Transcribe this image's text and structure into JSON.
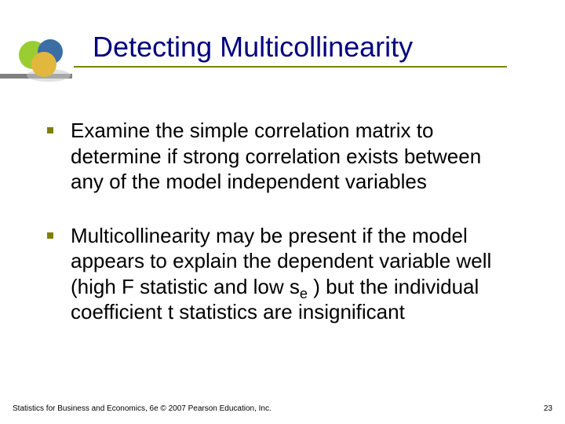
{
  "title": "Detecting Multicollinearity",
  "bullets": [
    {
      "text": "Examine the simple correlation matrix to determine if strong correlation exists between any of the model independent variables"
    },
    {
      "pre": "Multicollinearity may be present if the model appears to explain the dependent variable well (high  F  statistic and low  s",
      "sub": "e",
      "post": " ) but  the individual coefficient  t  statistics are insignificant"
    }
  ],
  "footer": {
    "left": "Statistics for Business and Economics, 6e © 2007 Pearson Education, Inc.",
    "page": "23"
  },
  "logo": {
    "circle_green": "#9ACD32",
    "circle_blue": "#3A6EA5",
    "circle_yellow": "#E1B83B",
    "shadow": "#B8B8B8"
  }
}
